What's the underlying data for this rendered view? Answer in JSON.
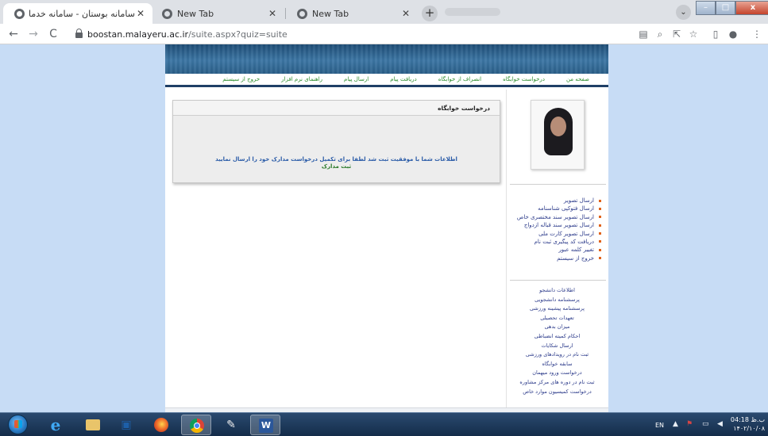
{
  "browser": {
    "tabs": [
      {
        "title": "سامانه بوستان - سامانه خدمات الکترونیک د",
        "active": true
      },
      {
        "title": "New Tab",
        "active": false
      },
      {
        "title": "New Tab",
        "active": false
      }
    ],
    "close_glyph": "✕",
    "new_tab_glyph": "+",
    "url_domain": "boostan.malayeru.ac.ir",
    "url_path": "/suite.aspx?quiz=suite",
    "back_glyph": "←",
    "forward_glyph": "→",
    "reload_glyph": "C",
    "toolbar_icons": [
      "translate-icon",
      "zoom-icon",
      "share-icon",
      "bookmark-star-icon",
      "sidebar-panel-icon",
      "profile-icon",
      "menu-icon"
    ]
  },
  "site": {
    "nav": [
      "صفحه من",
      "درخواست خوابگاه",
      "انصراف از خوابگاه",
      "دریافت پیام",
      "ارسال پیام",
      "راهنمای نرم افزار",
      "خروج از سیستم"
    ],
    "menu_items": [
      "ارسال تصویر",
      "ارسال فتوکپی شناسنامه",
      "ارسال تصویر سند مختصری خاص",
      "ارسال تصویر سند قباله ازدواج",
      "ارسال تصویر کارت ملی",
      "دریافت کد پیگیری ثبت نام",
      "تغییر کلمه عبور",
      "خروج از سیستم"
    ],
    "info_links": [
      "اطلاعات دانشجو",
      "پرسشنامه دانشجویی",
      "پرسشنامه پیشینه ورزشی",
      "تعهدات تحصیلی",
      "میزان بدهی",
      "احکام کمیته انضباطی",
      "ارسال شکایات",
      "ثبت نام در رویدادهای ورزشی",
      "سابقه خوابگاه",
      "درخواست ورود میهمان",
      "ثبت نام در دوره های مرکز مشاوره",
      "درخواست کمیسیون موارد خاص"
    ],
    "panel_title": "درخواست خوابگاه",
    "message_line1": "اطلاعات شما با موفقیت ثبت شد لطفا برای تکمیل درخواست مدارک خود را ارسال نمایید",
    "message_link": "ثبت مدارک"
  },
  "taskbar": {
    "apps": [
      "internet-explorer-icon",
      "file-explorer-icon",
      "media-player-icon",
      "firefox-icon",
      "chrome-icon",
      "paint-icon",
      "word-icon"
    ],
    "language": "EN",
    "time": "04:18 ب.ظ",
    "date": "۱۴۰۲/۱۰/۰۸"
  },
  "colors": {
    "page_background": "#c7dcf5",
    "header_blue": "#2b5f89",
    "nav_green": "#2a8a2a",
    "link_blue": "#2b3a8a",
    "bullet_orange": "#e0621a"
  }
}
